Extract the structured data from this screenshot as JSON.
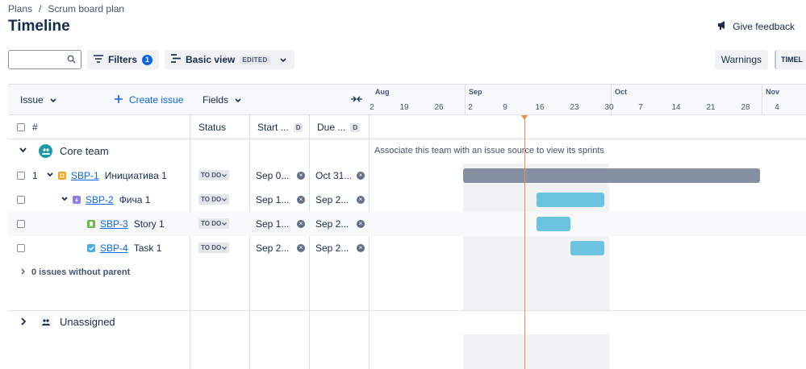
{
  "breadcrumb": {
    "plans": "Plans",
    "separator": "/",
    "plan": "Scrum board plan"
  },
  "page_title": "Timeline",
  "feedback_label": "Give feedback",
  "toolbar": {
    "search_value": "",
    "filters_label": "Filters",
    "filters_count": "1",
    "view_label": "Basic view",
    "view_edited": "EDITED",
    "warnings_label": "Warnings",
    "timeline_tab": "TIMEL"
  },
  "header": {
    "issue": "Issue",
    "create_issue": "Create issue",
    "fields": "Fields",
    "hash": "#",
    "status": "Status",
    "start": "Start ...",
    "due": "Due ...",
    "d_chip": "D"
  },
  "months": [
    {
      "label": "Aug"
    },
    {
      "label": "Sep"
    },
    {
      "label": "Oct"
    },
    {
      "label": "Nov"
    }
  ],
  "days": [
    "2",
    "19",
    "26",
    "2",
    "9",
    "16",
    "23",
    "30",
    "7",
    "14",
    "21",
    "28",
    "4"
  ],
  "team": {
    "name": "Core team",
    "sprint_message": "Associate this team with an issue source to view its sprints"
  },
  "issues": [
    {
      "rank": "1",
      "key": "SBP-1",
      "summary": "Инициатива 1",
      "status": "TO DO",
      "start": "Sep 0...",
      "due": "Oct 31...",
      "type": "initiative",
      "color": "#8590a2"
    },
    {
      "rank": "",
      "key": "SBP-2",
      "summary": "Фича 1",
      "status": "TO DO",
      "start": "Sep 1...",
      "due": "Sep 2...",
      "type": "epic",
      "color": "#6cc3e0"
    },
    {
      "rank": "",
      "key": "SBP-3",
      "summary": "Story 1",
      "status": "TO DO",
      "start": "Sep 1...",
      "due": "Sep 2...",
      "type": "story",
      "color": "#6cc3e0"
    },
    {
      "rank": "",
      "key": "SBP-4",
      "summary": "Task 1",
      "status": "TO DO",
      "start": "Sep 2...",
      "due": "Sep 2...",
      "type": "task",
      "color": "#6cc3e0"
    }
  ],
  "no_parent_label": "0 issues without parent",
  "unassigned_label": "Unassigned"
}
